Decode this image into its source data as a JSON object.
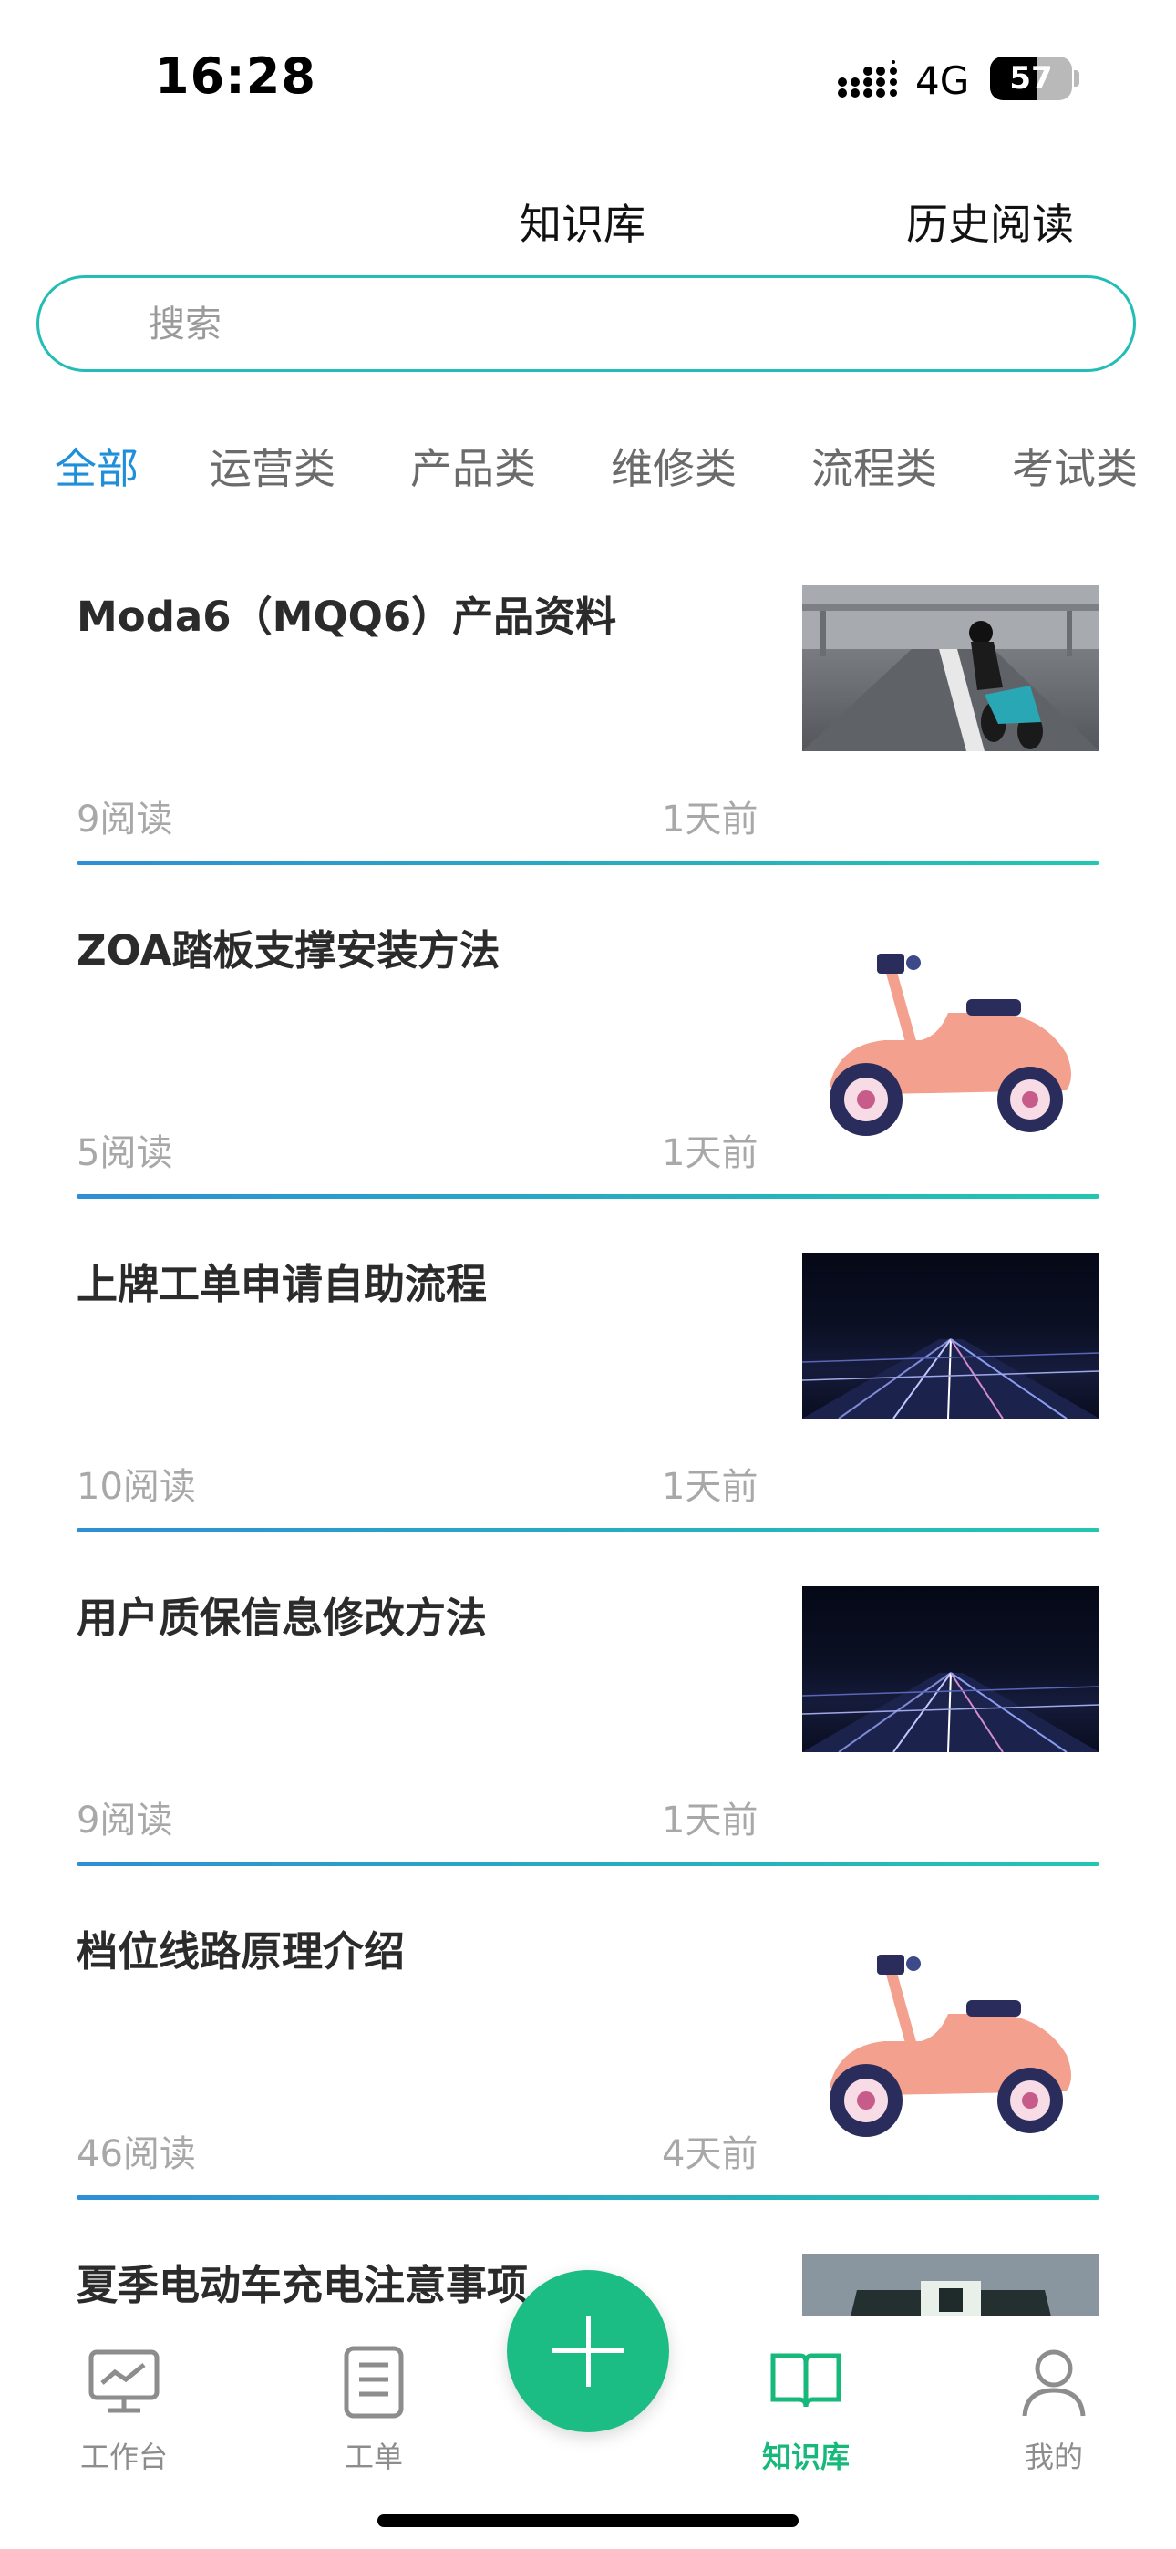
{
  "status_bar": {
    "time": "16:28",
    "network": "4G",
    "battery": "57",
    "battery_level": 0.57
  },
  "header": {
    "tabs": [
      "知识库",
      "历史阅读"
    ]
  },
  "search": {
    "placeholder": "搜索"
  },
  "categories": {
    "items": [
      "全部",
      "运营类",
      "产品类",
      "维修类",
      "流程类",
      "考试类"
    ],
    "active": "全部"
  },
  "articles": [
    {
      "title": "Moda6（MQQ6）产品资料",
      "reads": "9阅读",
      "time": "1天前",
      "thumbnail": "motorcycle-photo"
    },
    {
      "title": "ZOA踏板支撑安装方法",
      "reads": "5阅读",
      "time": "1天前",
      "thumbnail": "scooter-illustration"
    },
    {
      "title": "上牌工单申请自助流程",
      "reads": "10阅读",
      "time": "1天前",
      "thumbnail": "light-speed-photo"
    },
    {
      "title": "用户质保信息修改方法",
      "reads": "9阅读",
      "time": "1天前",
      "thumbnail": "light-speed-photo"
    },
    {
      "title": "档位线路原理介绍",
      "reads": "46阅读",
      "time": "4天前",
      "thumbnail": "scooter-illustration"
    },
    {
      "title": "夏季电动车充电注意事项",
      "reads": "",
      "time": "",
      "thumbnail": "store-building-photo"
    }
  ],
  "bottom_nav": {
    "items": [
      {
        "label": "工作台",
        "icon": "monitor-chart-icon"
      },
      {
        "label": "工单",
        "icon": "clipboard-icon"
      },
      {
        "label": "知识库",
        "icon": "open-book-icon",
        "active": true
      },
      {
        "label": "我的",
        "icon": "user-icon"
      }
    ],
    "fab_icon": "plus-icon"
  },
  "colors": {
    "accent": "#1e8fd8",
    "teal": "#22bdb5",
    "green": "#1bbd85"
  }
}
